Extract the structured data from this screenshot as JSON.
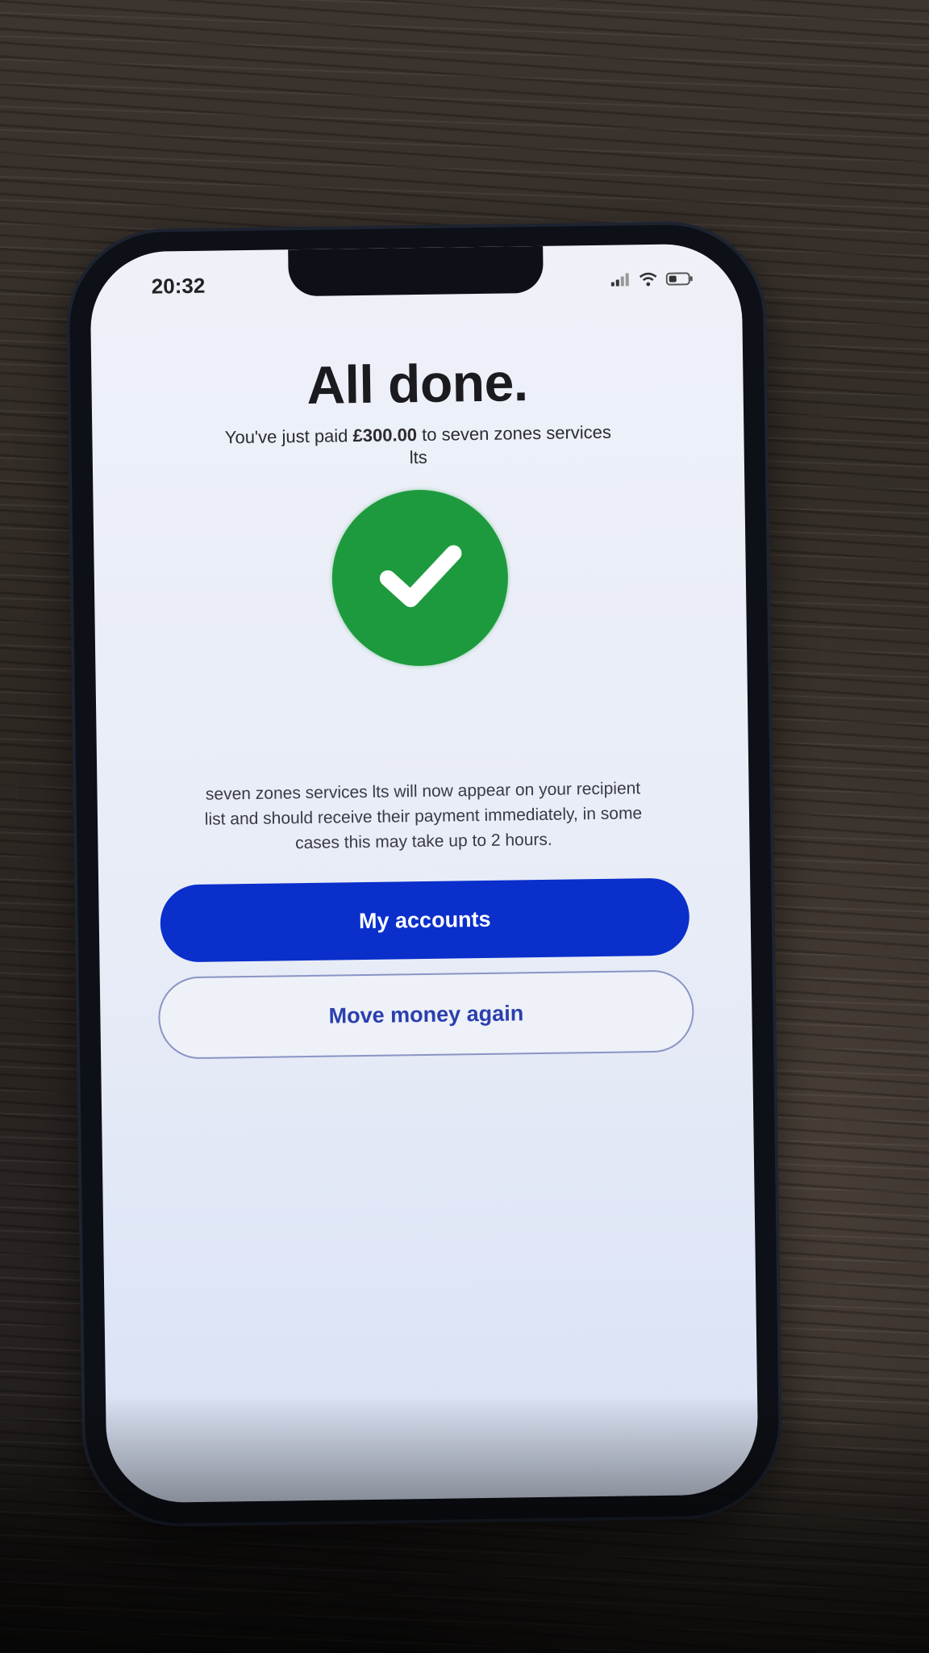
{
  "status_bar": {
    "time": "20:32"
  },
  "confirmation": {
    "title": "All done.",
    "subtitle_prefix": "You've just paid ",
    "amount": "£300.00",
    "subtitle_suffix": " to seven zones services lts",
    "info": "seven zones services lts will now appear on your recipient list and should receive their payment immediately, in some cases this may take up to 2 hours."
  },
  "actions": {
    "primary_label": "My accounts",
    "secondary_label": "Move money again"
  },
  "colors": {
    "success_green": "#1e9a3e",
    "primary_button": "#0a2fcb",
    "secondary_text": "#2a3fae"
  },
  "icons": {
    "success": "checkmark-icon",
    "signal": "signal-icon",
    "wifi": "wifi-icon",
    "battery": "battery-icon"
  }
}
